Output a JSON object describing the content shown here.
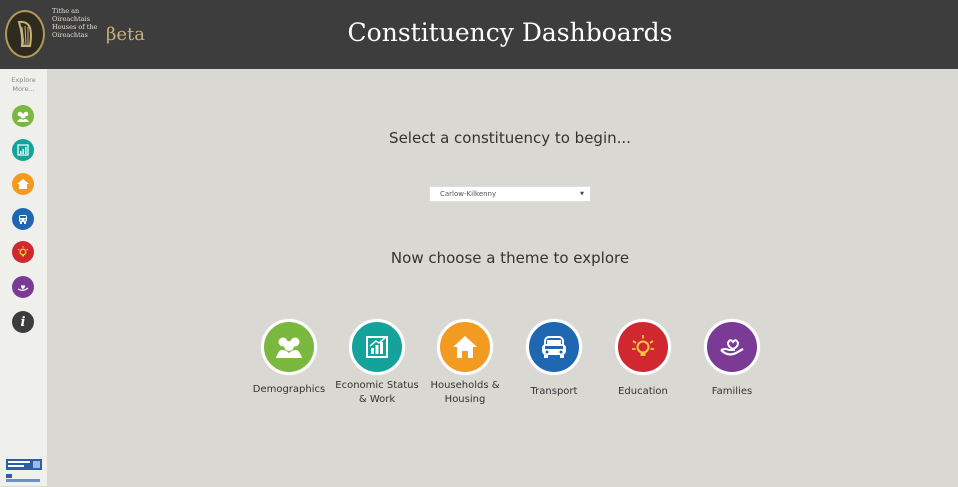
{
  "header": {
    "logo_text": [
      "Tithe an",
      "Oireachtais",
      "Houses of the",
      "Oireachtas"
    ],
    "beta": "βeta",
    "title": "Constituency Dashboards"
  },
  "sidebar": {
    "explore": "Explore More...",
    "icons": [
      {
        "name": "demographics-icon",
        "color": "#7ab83f"
      },
      {
        "name": "economic-icon",
        "color": "#14a39a"
      },
      {
        "name": "households-icon",
        "color": "#f39a22"
      },
      {
        "name": "transport-icon",
        "color": "#1f67b1"
      },
      {
        "name": "education-icon",
        "color": "#d1282f"
      },
      {
        "name": "families-icon",
        "color": "#7a3a95"
      },
      {
        "name": "info-icon",
        "color": "#3c3c3c"
      }
    ]
  },
  "main": {
    "prompt": "Select a constituency to begin...",
    "select_value": "Carlow-Kilkenny",
    "prompt2": "Now choose a theme to explore",
    "themes": [
      {
        "label": "Demographics",
        "color": "#7ab83f"
      },
      {
        "label": "Economic Status & Work",
        "color": "#14a39a"
      },
      {
        "label": "Households & Housing",
        "color": "#f39a22"
      },
      {
        "label": "Transport",
        "color": "#1f67b1"
      },
      {
        "label": "Education",
        "color": "#d1282f"
      },
      {
        "label": "Families",
        "color": "#7a3a95"
      }
    ]
  }
}
